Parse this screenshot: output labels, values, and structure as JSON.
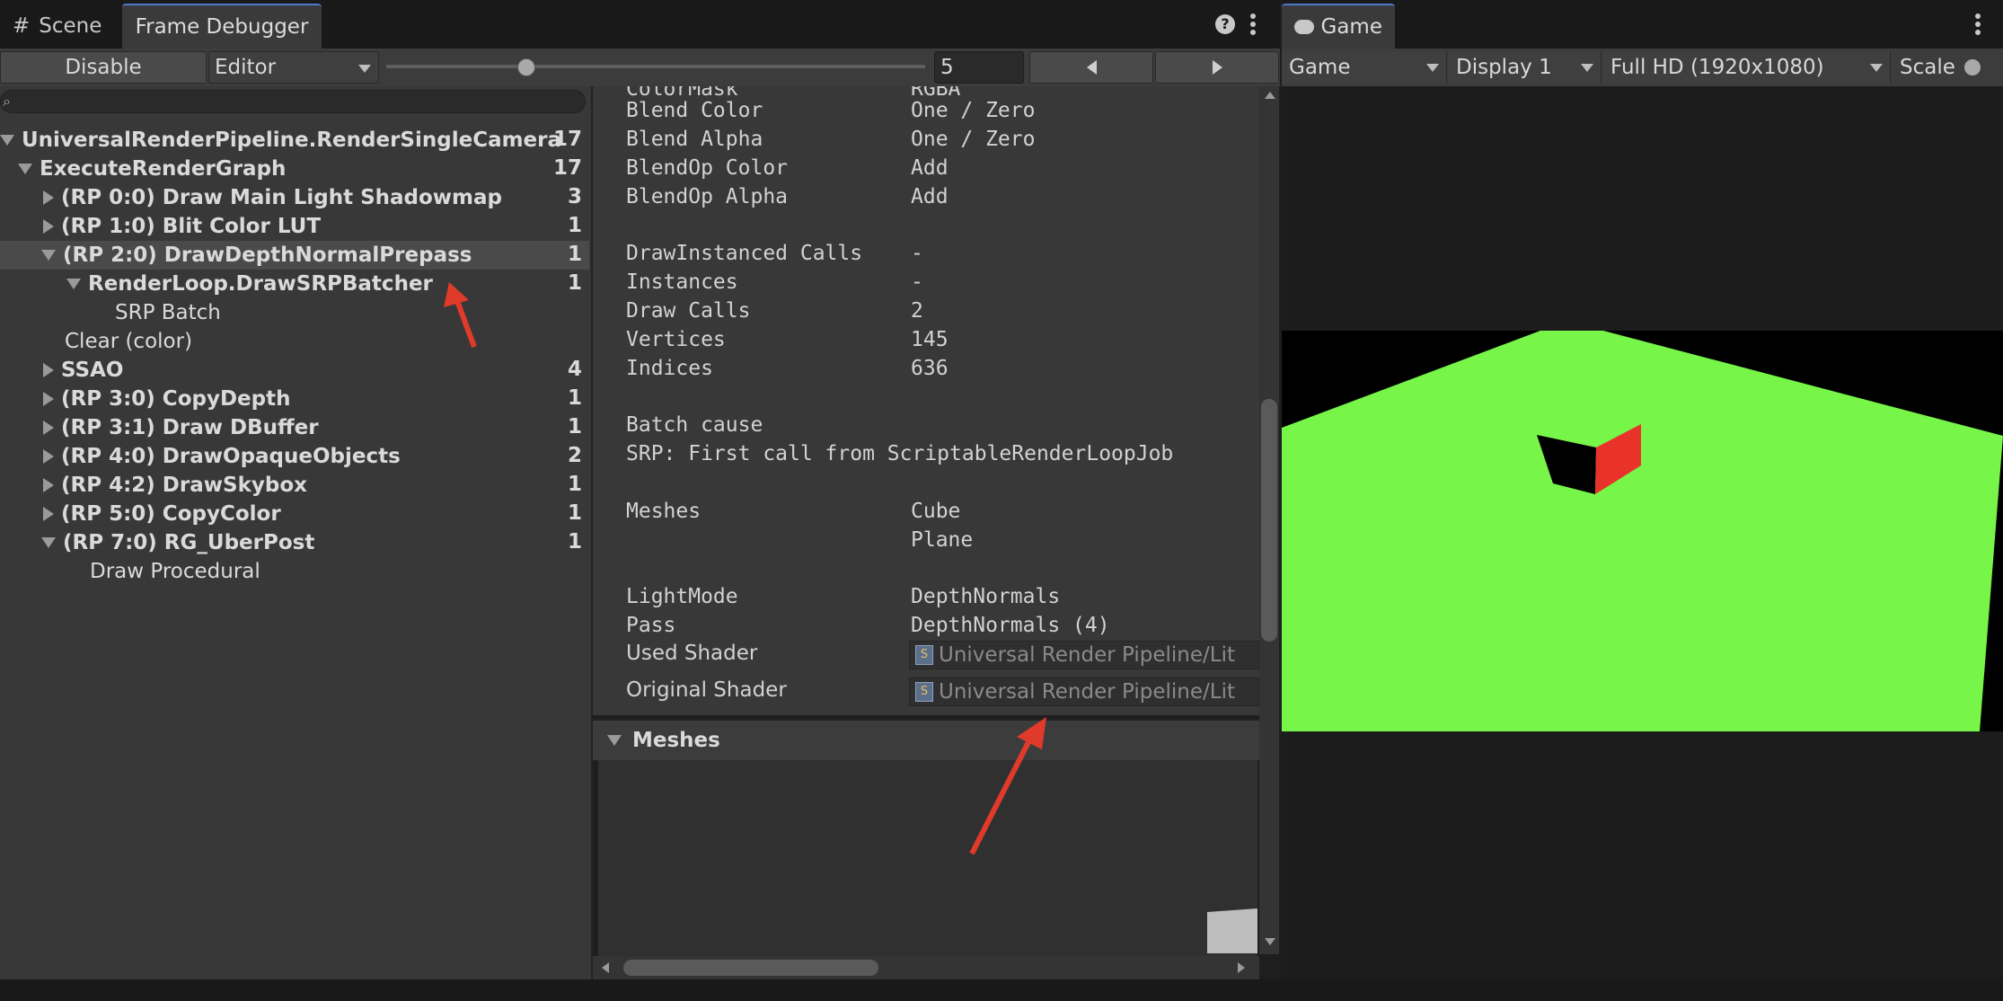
{
  "tabs": {
    "scene": "Scene",
    "frame_debugger": "Frame Debugger",
    "game": "Game"
  },
  "toolbar": {
    "disable_label": "Disable",
    "target_value": "Editor",
    "event_index": "5",
    "slider_fraction": 0.26
  },
  "search": {
    "placeholder": ""
  },
  "tree": {
    "root": {
      "label": "UniversalRenderPipeline.RenderSingleCameraInternal",
      "count": "17"
    },
    "execute": {
      "label": "ExecuteRenderGraph",
      "count": "17"
    },
    "items": [
      {
        "label": "(RP 0:0) Draw Main Light Shadowmap",
        "count": "3"
      },
      {
        "label": "(RP 1:0) Blit Color LUT",
        "count": "1"
      },
      {
        "label": "(RP 2:0) DrawDepthNormalPrepass",
        "count": "1"
      },
      {
        "label": "RenderLoop.DrawSRPBatcher",
        "count": "1"
      },
      {
        "label": "SRP Batch",
        "count": ""
      },
      {
        "label": "Clear (color)",
        "count": ""
      },
      {
        "label": "SSAO",
        "count": "4"
      },
      {
        "label": "(RP 3:0) CopyDepth",
        "count": "1"
      },
      {
        "label": "(RP 3:1) Draw DBuffer",
        "count": "1"
      },
      {
        "label": "(RP 4:0) DrawOpaqueObjects",
        "count": "2"
      },
      {
        "label": "(RP 4:2) DrawSkybox",
        "count": "1"
      },
      {
        "label": "(RP 5:0) CopyColor",
        "count": "1"
      },
      {
        "label": "(RP 7:0) RG_UberPost",
        "count": "1"
      },
      {
        "label": "Draw Procedural",
        "count": ""
      }
    ]
  },
  "details": {
    "partial_top": {
      "key": "ColorMask",
      "value": "RGBA"
    },
    "blend": [
      {
        "key": "Blend Color",
        "value": "One / Zero"
      },
      {
        "key": "Blend Alpha",
        "value": "One / Zero"
      },
      {
        "key": "BlendOp Color",
        "value": "Add"
      },
      {
        "key": "BlendOp Alpha",
        "value": "Add"
      }
    ],
    "stats": [
      {
        "key": "DrawInstanced Calls",
        "value": "-"
      },
      {
        "key": "Instances",
        "value": "-"
      },
      {
        "key": "Draw Calls",
        "value": "2"
      },
      {
        "key": "Vertices",
        "value": "145"
      },
      {
        "key": "Indices",
        "value": "636"
      }
    ],
    "batch_cause_label": "Batch cause",
    "batch_cause_value": "SRP: First call from ScriptableRenderLoopJob",
    "meshes_label": "Meshes",
    "meshes": [
      "Cube",
      "Plane"
    ],
    "lightmode_label": "LightMode",
    "lightmode_value": "DepthNormals",
    "pass_label": "Pass",
    "pass_value": "DepthNormals (4)",
    "used_shader_label": "Used Shader",
    "used_shader_value": "Universal Render Pipeline/Lit",
    "original_shader_label": "Original Shader",
    "original_shader_value": "Universal Render Pipeline/Lit"
  },
  "meshes_section": {
    "title": "Meshes"
  },
  "game": {
    "mode": "Game",
    "display": "Display 1",
    "resolution": "Full HD (1920x1080)",
    "scale_label": "Scale"
  },
  "colors": {
    "ground": "#77f548",
    "cube_red": "#e8322a",
    "arrow": "#e03a2a"
  }
}
